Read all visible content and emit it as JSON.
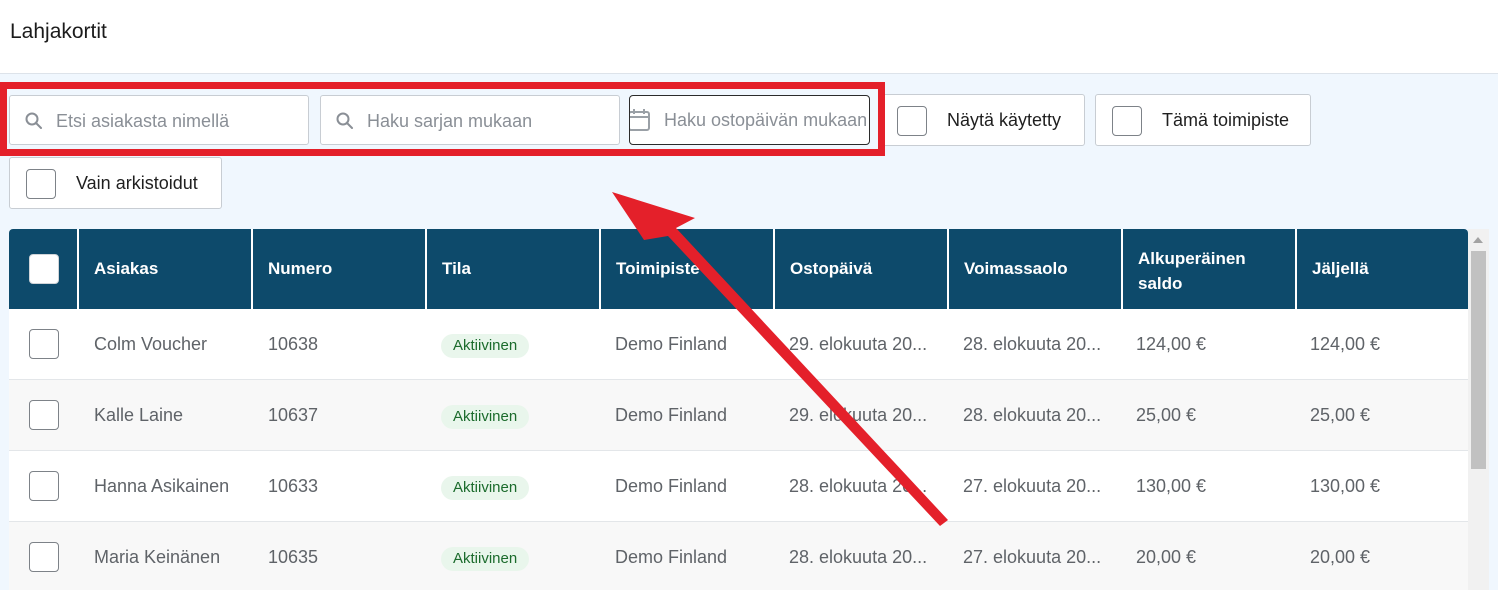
{
  "header": {
    "title": "Lahjakortit"
  },
  "filters": {
    "customer_search_placeholder": "Etsi asiakasta nimellä",
    "series_search_placeholder": "Haku sarjan mukaan",
    "purchase_date_placeholder": "Haku ostopäivän mukaan",
    "show_used_label": "Näytä käytetty",
    "this_location_label": "Tämä toimipiste",
    "only_archived_label": "Vain arkistoidut"
  },
  "table": {
    "columns": [
      "Asiakas",
      "Numero",
      "Tila",
      "Toimipiste",
      "Ostopäivä",
      "Voimassaolo",
      "Alkuperäinen saldo",
      "Jäljellä"
    ],
    "rows": [
      {
        "customer": "Colm Voucher",
        "number": "10638",
        "status": "Aktiivinen",
        "location": "Demo Finland",
        "purchase_date": "29. elokuuta 20...",
        "valid_until": "28. elokuuta 20...",
        "original_balance": "124,00 €",
        "remaining": "124,00 €"
      },
      {
        "customer": "Kalle Laine",
        "number": "10637",
        "status": "Aktiivinen",
        "location": "Demo Finland",
        "purchase_date": "29. elokuuta 20...",
        "valid_until": "28. elokuuta 20...",
        "original_balance": "25,00 €",
        "remaining": "25,00 €"
      },
      {
        "customer": "Hanna Asikainen",
        "number": "10633",
        "status": "Aktiivinen",
        "location": "Demo Finland",
        "purchase_date": "28. elokuuta 20...",
        "valid_until": "27. elokuuta 20...",
        "original_balance": "130,00 €",
        "remaining": "130,00 €"
      },
      {
        "customer": "Maria Keinänen",
        "number": "10635",
        "status": "Aktiivinen",
        "location": "Demo Finland",
        "purchase_date": "28. elokuuta 20...",
        "valid_until": "27. elokuuta 20...",
        "original_balance": "20,00 €",
        "remaining": "20,00 €"
      }
    ]
  },
  "colors": {
    "header_bg": "#0d4a6b",
    "highlight": "#e4202a",
    "badge_bg": "#e9f6ec",
    "badge_text": "#1b6b2c"
  }
}
